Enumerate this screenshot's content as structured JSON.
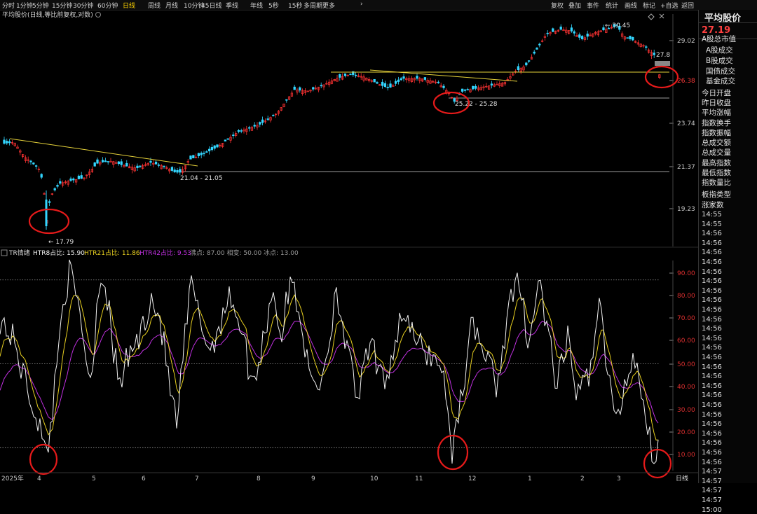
{
  "toolbar": {
    "periods": [
      "分时",
      "1分钟",
      "5分钟",
      "15分钟",
      "30分钟",
      "60分钟",
      "日线",
      "周线",
      "月线",
      "10分钟",
      "45日线",
      "季线",
      "年线",
      "5秒",
      "15秒",
      "多周期",
      "更多"
    ],
    "active_period": "日线",
    "right_items": [
      "复权",
      "叠加",
      "事件",
      "统计",
      "画线",
      "标记",
      "+自选",
      "返回"
    ],
    "right_close_icon": "close-icon",
    "right_diamond_icon": "diamond-icon",
    "more_arrow_icon": "chevron-right-icon"
  },
  "main_chart": {
    "title": "平均股价(日线,等比前复权,对数)",
    "price_labels": [
      "29.02",
      "26.38",
      "23.74",
      "21.37",
      "19.23"
    ],
    "annotations": {
      "low": "17.79",
      "high": "30.45",
      "last": "27.8",
      "gap1": "21.04 - 21.05",
      "gap2": "25.22 - 25.28"
    },
    "colors": {
      "up": "#ff3333",
      "down": "#33d6ff",
      "trendline": "#e6d23a",
      "circle": "#e51a1a"
    }
  },
  "indicator": {
    "name": "TR情绪",
    "htr8_label": "HTR8占比: 15.90",
    "htr21_label": "HTR21占比: 11.86",
    "htr42_label": "HTR42占比: 9.53",
    "extra_label": "沸点: 87.00  相变: 50.00  冰点: 13.00",
    "levels": [
      "90.00",
      "80.00",
      "70.00",
      "60.00",
      "50.00",
      "40.00",
      "30.00",
      "20.00",
      "10.00"
    ],
    "colors": {
      "htr8": "#f2f2f2",
      "htr21": "#e8d020",
      "htr42": "#c030e0"
    }
  },
  "x_axis": {
    "labels": [
      "2025年",
      "4",
      "5",
      "6",
      "7",
      "8",
      "9",
      "10",
      "11",
      "12",
      "1",
      "2",
      "3"
    ],
    "period_label": "日线"
  },
  "right_panel": {
    "title": "平均股价",
    "price": "27.19",
    "items": [
      "A股总市值",
      "A股成交",
      "B股成交",
      "国债成交",
      "基金成交",
      "今日开盘",
      "昨日收盘",
      "平均涨幅",
      "指数换手",
      "指数振幅",
      "总成交额",
      "总成交量",
      "最高指数",
      "最低指数",
      "指数量比",
      "板指类型",
      "涨家数"
    ],
    "times": [
      "14:55",
      "14:55",
      "14:56",
      "14:56",
      "14:56",
      "14:56",
      "14:56",
      "14:56",
      "14:56",
      "14:56",
      "14:56",
      "14:56",
      "14:56",
      "14:56",
      "14:56",
      "14:56",
      "14:56",
      "14:56",
      "14:56",
      "14:56",
      "14:56",
      "14:56",
      "14:56",
      "14:56",
      "14:56",
      "14:56",
      "14:56",
      "14:57",
      "14:57",
      "14:57",
      "14:57",
      "15:00"
    ]
  }
}
